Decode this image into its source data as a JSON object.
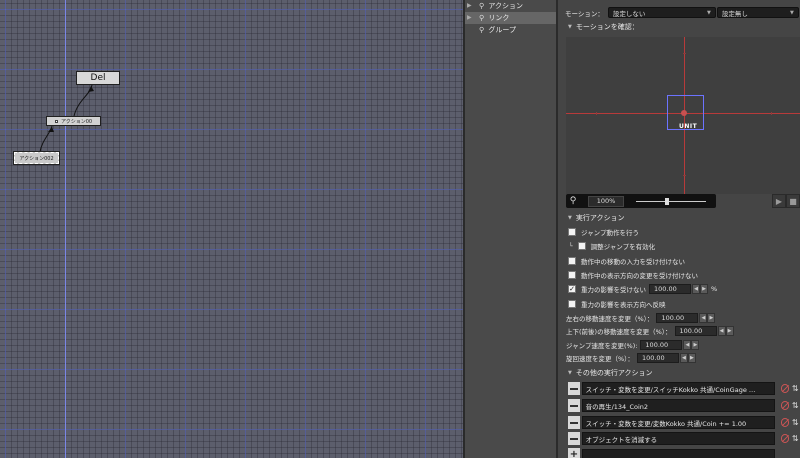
{
  "canvas": {
    "nodes": {
      "del": "Del",
      "action00": "アクション00",
      "action002": "アクション002"
    }
  },
  "tree": {
    "items": [
      {
        "label": "アクション",
        "selected": false
      },
      {
        "label": "リンク",
        "selected": true
      },
      {
        "label": "グループ",
        "selected": false
      }
    ]
  },
  "props": {
    "motion_label": "モーション：",
    "motion_value": "設定しない",
    "motion_value2": "設定無し",
    "motion_preview_header": "モーションを確認：",
    "unit_label": "UNIT",
    "zoom_value": "100%",
    "exec_action_header": "実行アクション",
    "checks": [
      {
        "label": "ジャンプ動作を行う",
        "checked": false
      },
      {
        "label": "調整ジャンプを有効化",
        "checked": false
      },
      {
        "label": "動作中の移動の入力を受け付けない",
        "checked": false
      },
      {
        "label": "動作中の表示方向の変更を受け付けない",
        "checked": false
      },
      {
        "label": "重力の影響を受けない",
        "checked": true,
        "value": "100.00",
        "unit": "%"
      },
      {
        "label": "重力の影響を表示方向へ反映",
        "checked": false
      }
    ],
    "fields": [
      {
        "label": "左右の移動速度を変更（%）：",
        "value": "100.00"
      },
      {
        "label": "上下(前後)の移動速度を変更（%）：",
        "value": "100.00"
      },
      {
        "label": "ジャンプ速度を変更(%):",
        "value": "100.00"
      },
      {
        "label": "旋回速度を変更（%）：",
        "value": "100.00"
      }
    ],
    "other_action_header": "その他の実行アクション",
    "other_actions": [
      "スイッチ・変数を変更/スイッチKokko 共通/CoinGage …",
      "音の再生/134_Coin2",
      "スイッチ・変数を変更/変数Kokko 共通/Coin += 1.00",
      "オブジェクトを消滅する"
    ],
    "add_symbol": "+"
  },
  "colors": {
    "grid_major": "#5f6ecd",
    "canvas_bg": "#5c5e6c",
    "crosshair": "#b83a3a",
    "unit_box": "#6c73ff"
  }
}
